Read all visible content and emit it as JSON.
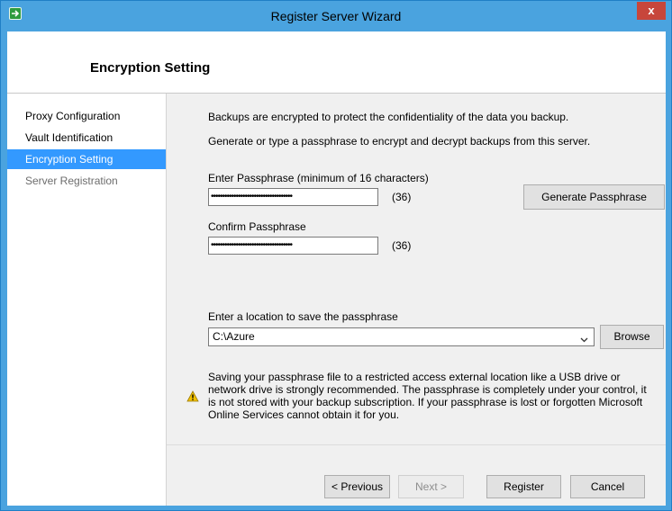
{
  "window": {
    "title": "Register Server Wizard",
    "close_glyph": "x"
  },
  "header": {
    "title": "Encryption Setting"
  },
  "nav": {
    "items": [
      {
        "label": "Proxy Configuration",
        "state": "done"
      },
      {
        "label": "Vault Identification",
        "state": "done"
      },
      {
        "label": "Encryption Setting",
        "state": "active"
      },
      {
        "label": "Server Registration",
        "state": "disabled"
      }
    ]
  },
  "content": {
    "intro_1": "Backups are encrypted to protect the confidentiality of the data you backup.",
    "intro_2": "Generate or type a passphrase to encrypt and decrypt backups from this server.",
    "passphrase_label": "Enter Passphrase (minimum of 16 characters)",
    "passphrase_value": "••••••••••••••••••••••••••••••••••••",
    "passphrase_count": "(36)",
    "generate_button": "Generate Passphrase",
    "confirm_label": "Confirm Passphrase",
    "confirm_value": "••••••••••••••••••••••••••••••••••••",
    "confirm_count": "(36)",
    "location_label": "Enter a location to save the passphrase",
    "location_value": "C:\\Azure",
    "browse_button": "Browse",
    "warning_text": "Saving your passphrase file to a restricted access external location like a USB drive or network drive is strongly recommended. The passphrase is completely under your control, it is not stored with your backup subscription. If your passphrase is lost or forgotten Microsoft Online Services cannot obtain it for you."
  },
  "footer": {
    "previous_button": "< Previous",
    "next_button": "Next >",
    "register_button": "Register",
    "cancel_button": "Cancel"
  },
  "colors": {
    "titlebar": "#4aa3df",
    "nav_active": "#3399ff",
    "close_button": "#c7463b",
    "warning_icon": "#f2c200"
  },
  "icons": {
    "app": "app-icon",
    "close": "close-icon",
    "dropdown": "chevron-down-icon",
    "warning": "warning-icon"
  }
}
